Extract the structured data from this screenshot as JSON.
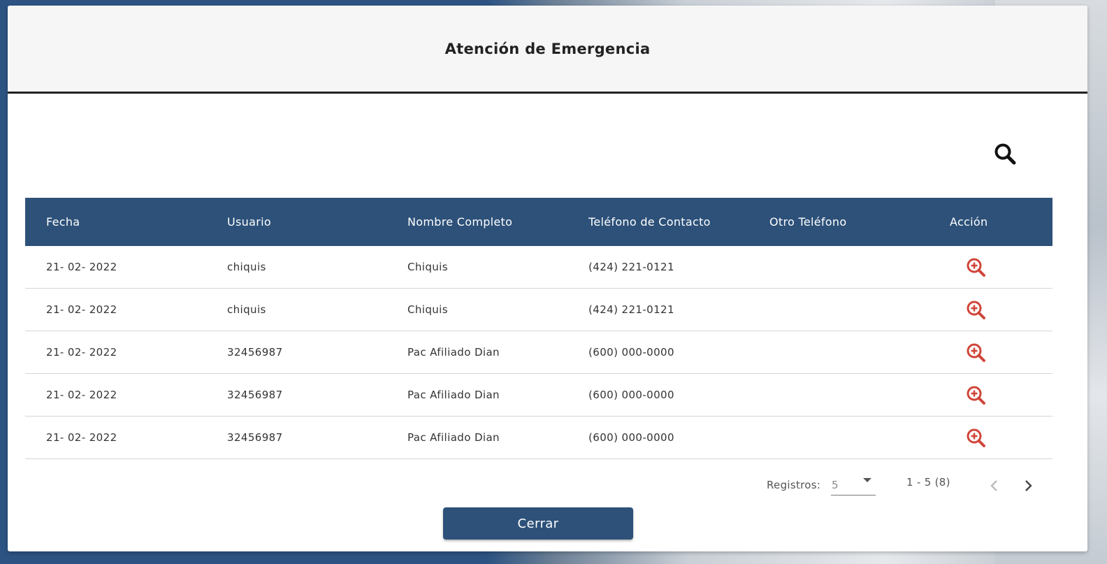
{
  "dialog": {
    "title": "Atención de Emergencia"
  },
  "search": {
    "icon": "search-icon"
  },
  "table": {
    "headers": [
      "Fecha",
      "Usuario",
      "Nombre Completo",
      "Teléfono de Contacto",
      "Otro Teléfono",
      "Acción"
    ],
    "rows": [
      {
        "fecha": "21- 02- 2022",
        "usuario": "chiquis",
        "nombre": "Chiquis",
        "telefono": "(424) 221-0121",
        "otro": "",
        "accion_icon": "zoom-in-icon"
      },
      {
        "fecha": "21- 02- 2022",
        "usuario": "chiquis",
        "nombre": "Chiquis",
        "telefono": "(424) 221-0121",
        "otro": "",
        "accion_icon": "zoom-in-icon"
      },
      {
        "fecha": "21- 02- 2022",
        "usuario": "32456987",
        "nombre": "Pac Afiliado Dian",
        "telefono": "(600) 000-0000",
        "otro": "",
        "accion_icon": "zoom-in-icon"
      },
      {
        "fecha": "21- 02- 2022",
        "usuario": "32456987",
        "nombre": "Pac Afiliado Dian",
        "telefono": "(600) 000-0000",
        "otro": "",
        "accion_icon": "zoom-in-icon"
      },
      {
        "fecha": "21- 02- 2022",
        "usuario": "32456987",
        "nombre": "Pac Afiliado Dian",
        "telefono": "(600) 000-0000",
        "otro": "",
        "accion_icon": "zoom-in-icon"
      }
    ]
  },
  "paginator": {
    "registros_label": "Registros:",
    "page_size": "5",
    "range_label": "1 - 5 (8)"
  },
  "buttons": {
    "close_label": "Cerrar"
  },
  "colors": {
    "primary": "#2d5179",
    "action_icon": "#d0453a",
    "header_bg": "#f6f6f6"
  }
}
